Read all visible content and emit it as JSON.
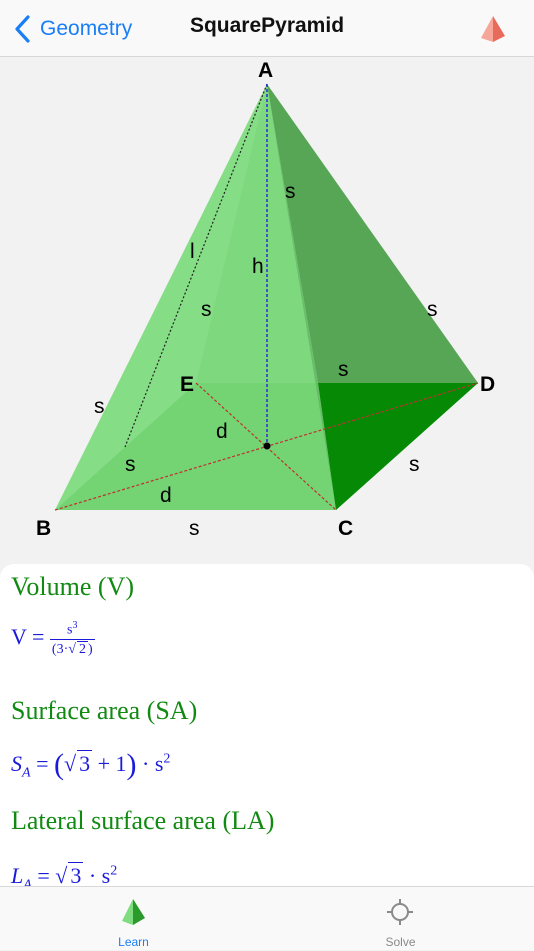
{
  "nav": {
    "back_label": "Geometry",
    "title": "SquarePyramid"
  },
  "diagram": {
    "vertices": {
      "a": "A",
      "b": "B",
      "c": "C",
      "d": "D",
      "e": "E"
    },
    "labels": {
      "slant": "l",
      "height": "h",
      "diag1": "d",
      "diag2": "d",
      "edge_ad": "s",
      "edge_ac": "s",
      "edge_ae": "s",
      "edge_de": "s",
      "edge_ab": "s",
      "edge_be": "s",
      "edge_bc": "s",
      "edge_cd": "s"
    },
    "colors": {
      "face_left": "#9be89b",
      "face_front": "#6fd46f",
      "face_right": "#56a656",
      "face_right_bottom": "#068a06",
      "base": "#7ad47a",
      "slant_line": "#222222",
      "height_line": "#2a2ae0",
      "diagonal_line": "#c0302e"
    }
  },
  "sections": [
    {
      "title": "Volume (V)"
    },
    {
      "title": "Surface area (SA)"
    },
    {
      "title": "Lateral surface area (LA)"
    }
  ],
  "formulas": {
    "volume": {
      "lhs": "V",
      "eq": "=",
      "num": "s",
      "num_exp": "3",
      "den_left": "(3·",
      "den_rad": "2",
      "den_right": ")"
    },
    "surface": {
      "lhs": "S",
      "sub": "A",
      "eq": "=",
      "rad": "3",
      "plus": "+ 1",
      "times": "·",
      "var": "s",
      "exp": "2"
    },
    "lateral": {
      "lhs": "L",
      "sub": "A",
      "eq": "=",
      "rad": "3",
      "times": "·",
      "var": "s",
      "exp": "2"
    }
  },
  "tabs": [
    {
      "label": "Learn",
      "active": true,
      "color": "#1a7ef5"
    },
    {
      "label": "Solve",
      "active": false,
      "color": "#8a8a8a"
    }
  ]
}
